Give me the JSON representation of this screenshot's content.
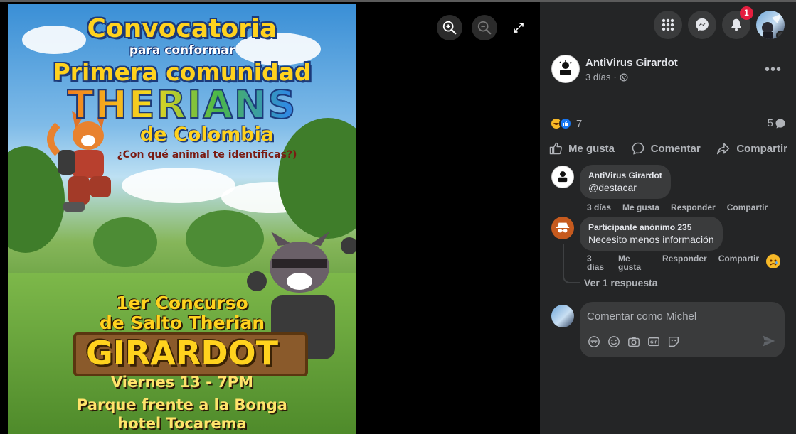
{
  "poster": {
    "line1": "Convocatoria",
    "line2": "para conformar",
    "line3": "Primera comunidad",
    "line4": "THERIANS",
    "line5": "de Colombia",
    "line6": "¿Con qué animal te identificas?)",
    "line7": "1er Concurso",
    "line8": "de Salto Therian",
    "line9": "GIRARDOT",
    "line10": "Viernes 13 - 7PM",
    "line11": "Parque frente a la Bonga",
    "line12": "hotel Tocarema"
  },
  "viewer": {
    "icons": [
      "zoom-in-icon",
      "zoom-out-icon",
      "fullscreen-icon"
    ]
  },
  "topbar": {
    "notifications_badge": "1",
    "icons": [
      "menu-grid-icon",
      "messenger-icon",
      "bell-icon"
    ]
  },
  "post": {
    "author": "AntiVirus Girardot",
    "time": "3 días",
    "reaction_count": "7",
    "comment_count": "5",
    "actions": {
      "like": "Me gusta",
      "comment": "Comentar",
      "share": "Compartir"
    }
  },
  "comments": [
    {
      "author": "AntiVirus Girardot",
      "text": "@destacar",
      "time": "3 días",
      "like": "Me gusta",
      "reply": "Responder",
      "share": "Compartir"
    },
    {
      "author": "Participante anónimo 235",
      "text": "Necesito menos información",
      "time_line1": "3",
      "time_line2": "días",
      "like_line1": "Me",
      "like_line2": "gusta",
      "reply": "Responder",
      "share": "Compartir",
      "view_replies": "Ver 1 respuesta"
    }
  ],
  "composer": {
    "placeholder": "Comentar como Michel"
  },
  "colors": {
    "panel_bg": "#242526",
    "bubble_bg": "#3a3b3c",
    "text_primary": "#e4e6eb",
    "text_secondary": "#b0b3b8",
    "badge_red": "#e41e3f",
    "like_blue": "#1877f2"
  }
}
